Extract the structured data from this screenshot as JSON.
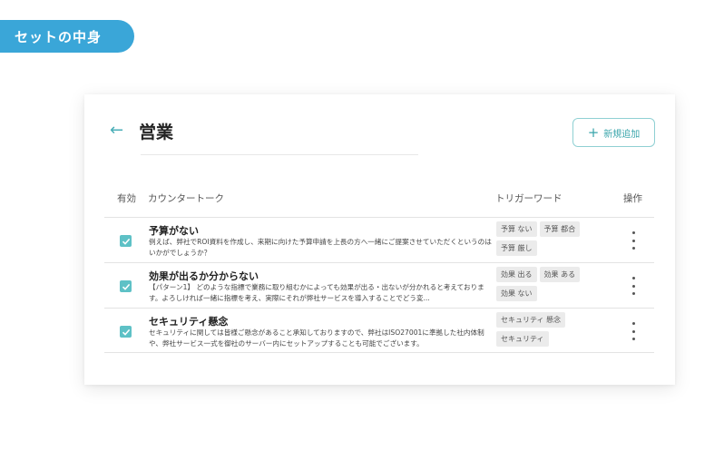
{
  "ribbon": {
    "label": "セットの中身"
  },
  "header": {
    "back_icon": "←",
    "title": "営業",
    "add_button": {
      "icon": "+",
      "label": "新規追加"
    }
  },
  "columns": {
    "enabled": "有効",
    "counter_talk": "カウンタートーク",
    "trigger_word": "トリガーワード",
    "actions": "操作"
  },
  "rows": [
    {
      "checked": true,
      "title": "予算がない",
      "body": "例えば、弊社でROI資料を作成し、来期に向けた予算申請を上長の方へ一緒にご提案させていただくというのはいかがでしょうか？",
      "tags": [
        "予算 ない",
        "予算 都合",
        "予算 厳し"
      ]
    },
    {
      "checked": true,
      "title": "効果が出るか分からない",
      "body": "【パターン1】 どのような指標で業務に取り組むかによっても効果が出る・出ないが分かれると考えております。よろしければ一緒に指標を考え、実際にそれが弊社サービスを導入することでどう変...",
      "tags": [
        "効果 出る",
        "効果 ある",
        "効果 ない"
      ]
    },
    {
      "checked": true,
      "title": "セキュリティ懸念",
      "body": "セキュリティに関しては皆様ご懸念があること承知しておりますので、弊社はISO27001に準拠した社内体制や、弊社サービス一式を御社のサーバー内にセットアップすることも可能でございます。",
      "tags": [
        "セキュリティ 懸念",
        "セキュリティ"
      ]
    }
  ],
  "colors": {
    "accent": "#5ec1c6",
    "ribbon": "#3aa6d8"
  }
}
